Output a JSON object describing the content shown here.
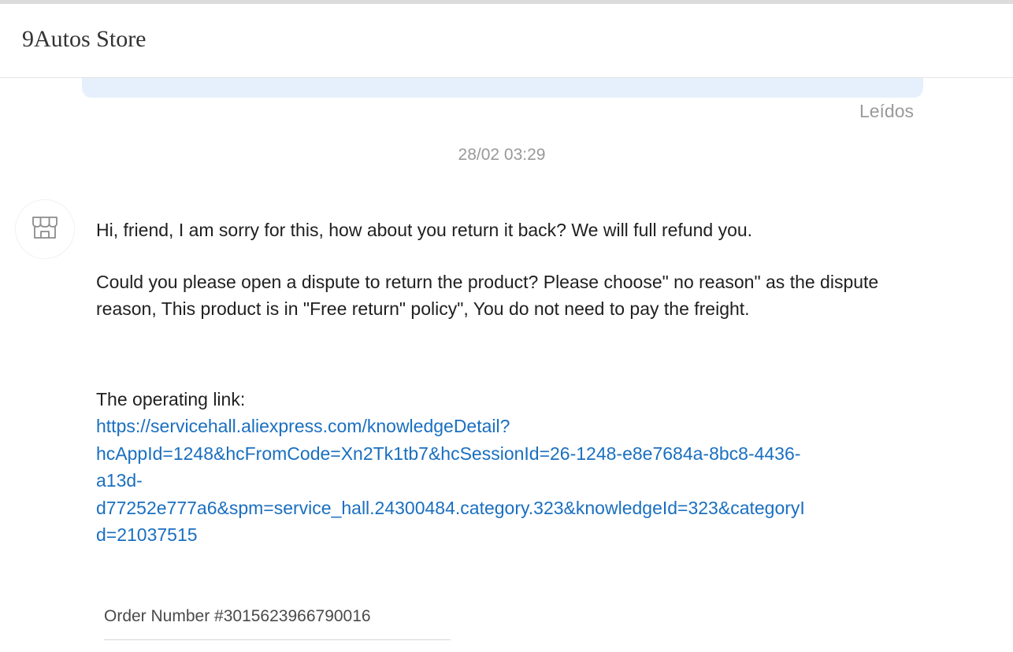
{
  "header": {
    "store_name": "9Autos Store"
  },
  "chat": {
    "read_status": "Leídos",
    "timestamp": "28/02 03:29",
    "message": {
      "sender_icon": "store-icon",
      "paragraph1": "Hi, friend, I am sorry for this, how about you return it back? We will full refund you.",
      "paragraph2": "Could you please open a dispute to return the product? Please choose\" no reason\" as the dispute reason, This product is in \"Free return\" policy\", You do not need to pay the freight.",
      "link_label": "The operating link:",
      "link_lines": [
        "https://servicehall.aliexpress.com/knowledgeDetail?",
        "hcAppId=1248&hcFromCode=Xn2Tk1tb7&hcSessionId=26-1248-e8e7684a-8bc8-4436-",
        "a13d-",
        "d77252e777a6&spm=service_hall.24300484.category.323&knowledgeId=323&categoryI",
        "d=21037515"
      ]
    },
    "order": {
      "label": "Order Number #3015623966790016"
    }
  },
  "colors": {
    "link": "#1a6fc0",
    "bubble_bg": "#e6f0fc",
    "muted_text": "#999999"
  }
}
